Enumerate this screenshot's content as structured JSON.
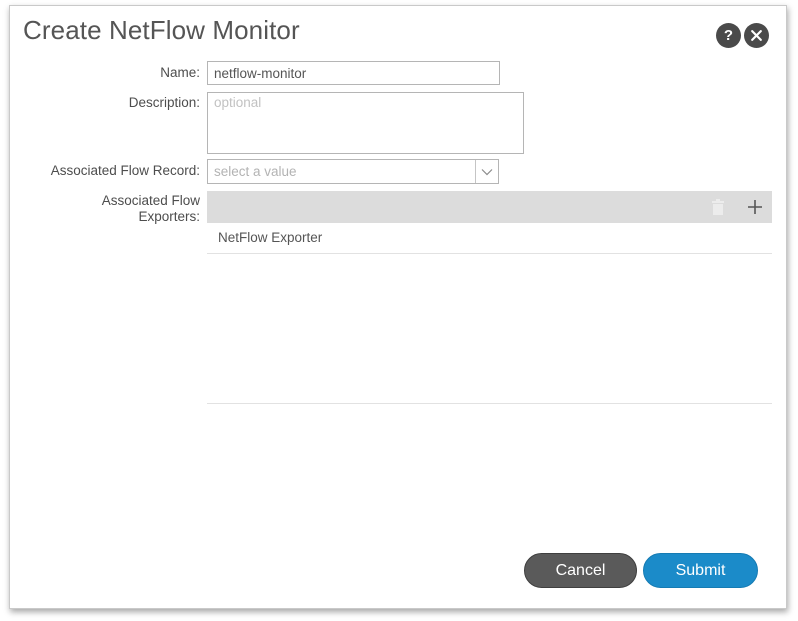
{
  "dialog": {
    "title": "Create NetFlow Monitor",
    "help_icon": "question-icon",
    "close_icon": "close-icon"
  },
  "form": {
    "name_label": "Name:",
    "name_value": "netflow-monitor",
    "description_label": "Description:",
    "description_placeholder": "optional",
    "description_value": "",
    "flow_record_label": "Associated Flow Record:",
    "flow_record_placeholder": "select a value",
    "flow_exporters_label_line1": "Associated Flow",
    "flow_exporters_label_line2": "Exporters:"
  },
  "exporters_table": {
    "delete_icon": "trash-icon",
    "add_icon": "plus-icon",
    "rows": [
      "NetFlow Exporter"
    ]
  },
  "footer": {
    "cancel_label": "Cancel",
    "submit_label": "Submit"
  },
  "colors": {
    "submit": "#1b8bc9",
    "cancel": "#5a5a5a",
    "table_header": "#dcdcdc"
  }
}
